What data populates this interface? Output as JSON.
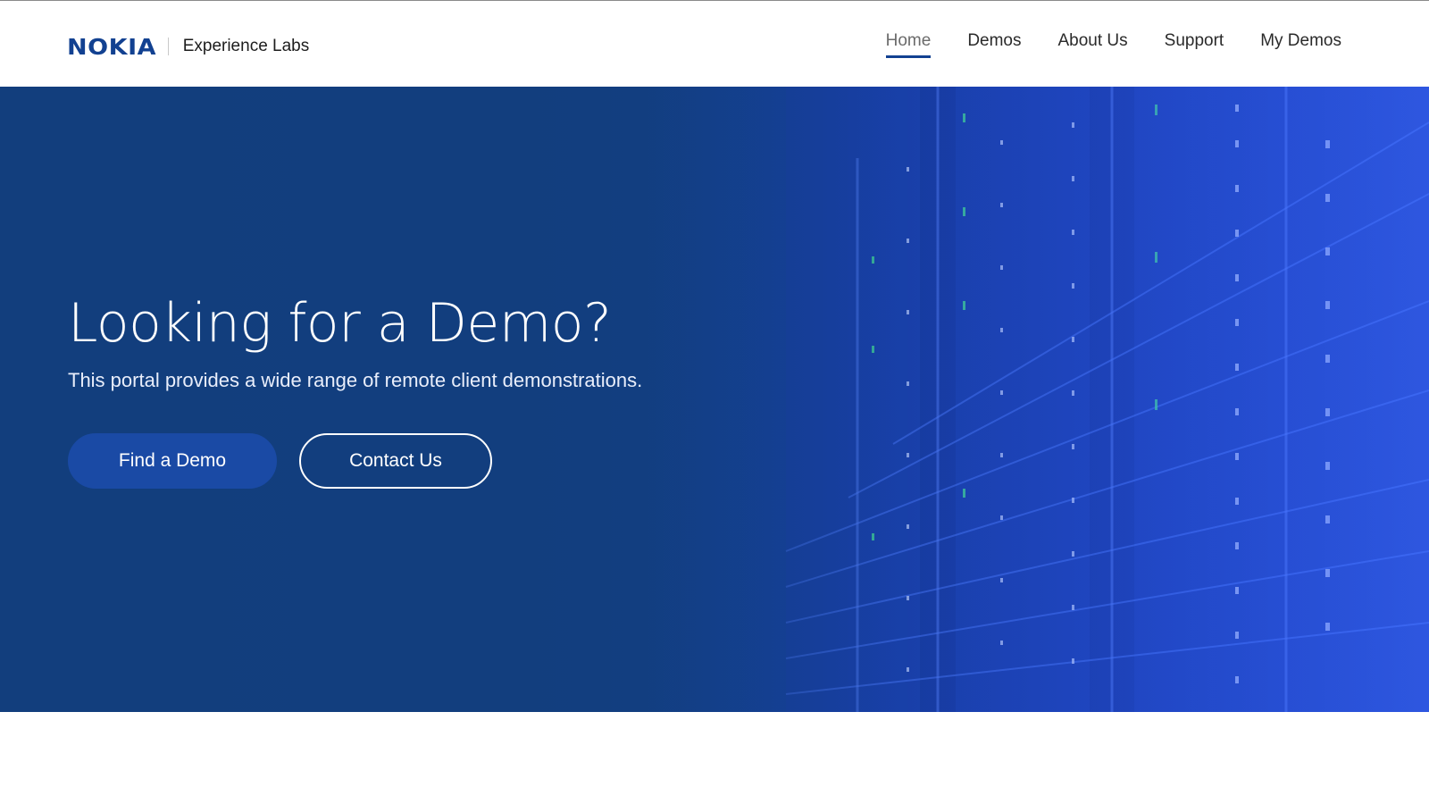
{
  "brand": {
    "logo_text": "NOKIA",
    "subtitle": "Experience Labs",
    "logo_color": "#124191"
  },
  "nav": {
    "items": [
      {
        "label": "Home",
        "active": true
      },
      {
        "label": "Demos",
        "active": false
      },
      {
        "label": "About Us",
        "active": false
      },
      {
        "label": "Support",
        "active": false
      },
      {
        "label": "My Demos",
        "active": false
      }
    ]
  },
  "hero": {
    "title": "Looking for a Demo?",
    "subtitle": "This portal provides a wide range of remote client demonstrations.",
    "primary_button": "Find a Demo",
    "secondary_button": "Contact Us",
    "background_image": "server-racks-illustration"
  },
  "colors": {
    "accent": "#124191",
    "hero_dark": "#123e7d",
    "hero_light": "#1f44d2",
    "button_primary": "#1a4aa5"
  }
}
